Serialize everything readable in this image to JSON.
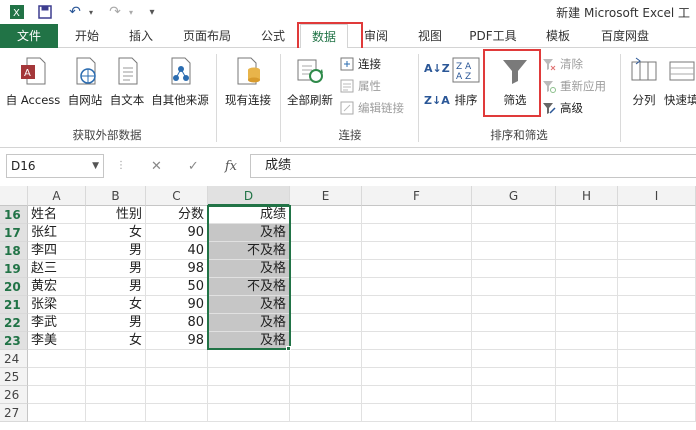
{
  "window": {
    "title": "新建 Microsoft Excel 工"
  },
  "tabs": [
    "文件",
    "开始",
    "插入",
    "页面布局",
    "公式",
    "数据",
    "审阅",
    "视图",
    "PDF工具",
    "模板",
    "百度网盘"
  ],
  "ribbon": {
    "external": {
      "buttons": [
        "自 Access",
        "自网站",
        "自文本",
        "自其他来源"
      ],
      "label": "获取外部数据"
    },
    "existing_conn": "现有连接",
    "connections": {
      "refresh_all": "全部刷新",
      "items": [
        "连接",
        "属性",
        "编辑链接"
      ],
      "label": "连接"
    },
    "sortfilter": {
      "sort_az": "A↓Z",
      "sort_za": "Z↓A",
      "sort": "排序",
      "filter": "筛选",
      "clear": "清除",
      "reapply": "重新应用",
      "advanced": "高级",
      "label": "排序和筛选"
    },
    "split": "分列",
    "quickfill": "快速填"
  },
  "formula_bar": {
    "name_box": "D16",
    "formula": "成绩",
    "cancel": "✕",
    "enter": "✓",
    "fx": "fx"
  },
  "columns": [
    "A",
    "B",
    "C",
    "D",
    "E",
    "F",
    "G",
    "H",
    "I"
  ],
  "rows": [
    {
      "num": "16",
      "cells": [
        "姓名",
        "性别",
        "分数",
        "成绩"
      ]
    },
    {
      "num": "17",
      "cells": [
        "张红",
        "女",
        "90",
        "及格"
      ]
    },
    {
      "num": "18",
      "cells": [
        "李四",
        "男",
        "40",
        "不及格"
      ]
    },
    {
      "num": "19",
      "cells": [
        "赵三",
        "男",
        "98",
        "及格"
      ]
    },
    {
      "num": "20",
      "cells": [
        "黄宏",
        "男",
        "50",
        "不及格"
      ]
    },
    {
      "num": "21",
      "cells": [
        "张梁",
        "女",
        "90",
        "及格"
      ]
    },
    {
      "num": "22",
      "cells": [
        "李武",
        "男",
        "80",
        "及格"
      ]
    },
    {
      "num": "23",
      "cells": [
        "李美",
        "女",
        "98",
        "及格"
      ]
    },
    {
      "num": "24",
      "cells": [
        "",
        "",
        "",
        ""
      ]
    },
    {
      "num": "25",
      "cells": [
        "",
        "",
        "",
        ""
      ]
    },
    {
      "num": "26",
      "cells": [
        "",
        "",
        "",
        ""
      ]
    },
    {
      "num": "27",
      "cells": [
        "",
        "",
        "",
        ""
      ]
    }
  ],
  "colors": {
    "excel_green": "#217346",
    "highlight_red": "#e03a3a",
    "selection_gray": "#c6c6c6"
  }
}
